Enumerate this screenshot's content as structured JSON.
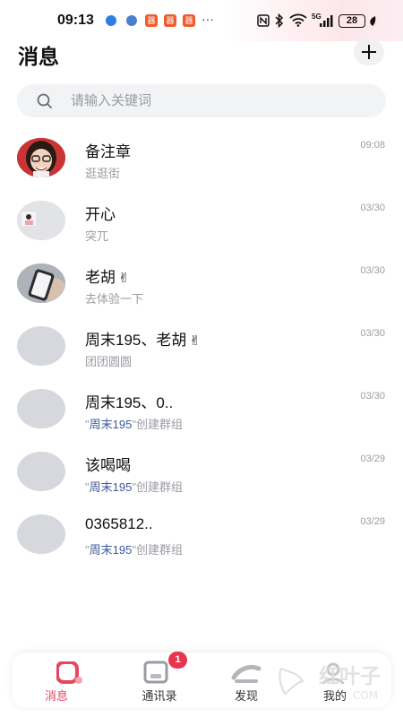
{
  "status_bar": {
    "time": "09:13",
    "more": "···",
    "network": "5G",
    "battery": "28",
    "app_badge": "器"
  },
  "header": {
    "title": "消息"
  },
  "search": {
    "placeholder": "请输入关键词"
  },
  "conversations": [
    {
      "name": "备注章",
      "preview": "逛逛街",
      "time": "09:08",
      "avatar": "cartoon-portrait"
    },
    {
      "name": "开心",
      "preview": "突兀",
      "time": "03/30",
      "avatar": "photo-small"
    },
    {
      "name": "老胡",
      "emoji": "✌",
      "preview": "去体验一下",
      "time": "03/30",
      "avatar": "phone-photo"
    },
    {
      "name": "周末195、老胡",
      "emoji": "✌",
      "preview": "团团圆圆",
      "time": "03/30",
      "avatar": "placeholder"
    },
    {
      "name": "周末195、0..",
      "preview_quote_open": "\"",
      "preview_highlight": "周末195",
      "preview_rest": "\"创建群组",
      "time": "03/30",
      "avatar": "placeholder"
    },
    {
      "name": "该喝喝",
      "preview_quote_open": "\"",
      "preview_highlight": "周末195",
      "preview_rest": "\"创建群组",
      "time": "03/29",
      "avatar": "placeholder"
    },
    {
      "name": "0365812..",
      "preview_quote_open": "\"",
      "preview_highlight": "周末195",
      "preview_rest": "\"创建群组",
      "time": "03/29",
      "avatar": "placeholder"
    }
  ],
  "tabs": [
    {
      "label": "消息",
      "icon": "chat-icon",
      "active": true
    },
    {
      "label": "通讯录",
      "icon": "contacts-icon",
      "badge": "1"
    },
    {
      "label": "发现",
      "icon": "discover-icon"
    },
    {
      "label": "我的",
      "icon": "profile-icon"
    }
  ],
  "watermark": {
    "text_main": "红叶子",
    "text_sub": ".COM"
  },
  "colors": {
    "accent": "#e8455e",
    "badge": "#e8354d",
    "highlight": "#3d5a99",
    "muted": "#9a9ca3"
  }
}
